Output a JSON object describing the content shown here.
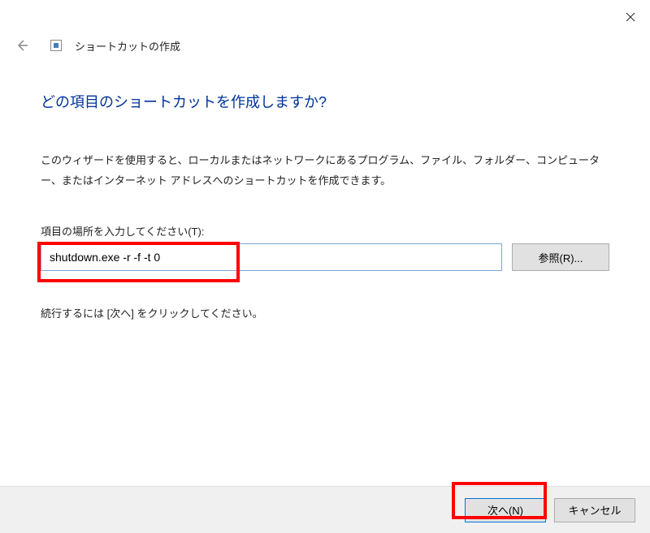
{
  "header": {
    "title": "ショートカットの作成"
  },
  "content": {
    "heading": "どの項目のショートカットを作成しますか?",
    "description": "このウィザードを使用すると、ローカルまたはネットワークにあるプログラム、ファイル、フォルダー、コンピューター、またはインターネット アドレスへのショートカットを作成できます。",
    "field_label": "項目の場所を入力してください(T):",
    "path_value": "shutdown.exe -r -f -t 0",
    "browse_label": "参照(R)...",
    "continue_text": "続行するには [次へ] をクリックしてください。"
  },
  "footer": {
    "next_label": "次へ(N)",
    "cancel_label": "キャンセル"
  }
}
